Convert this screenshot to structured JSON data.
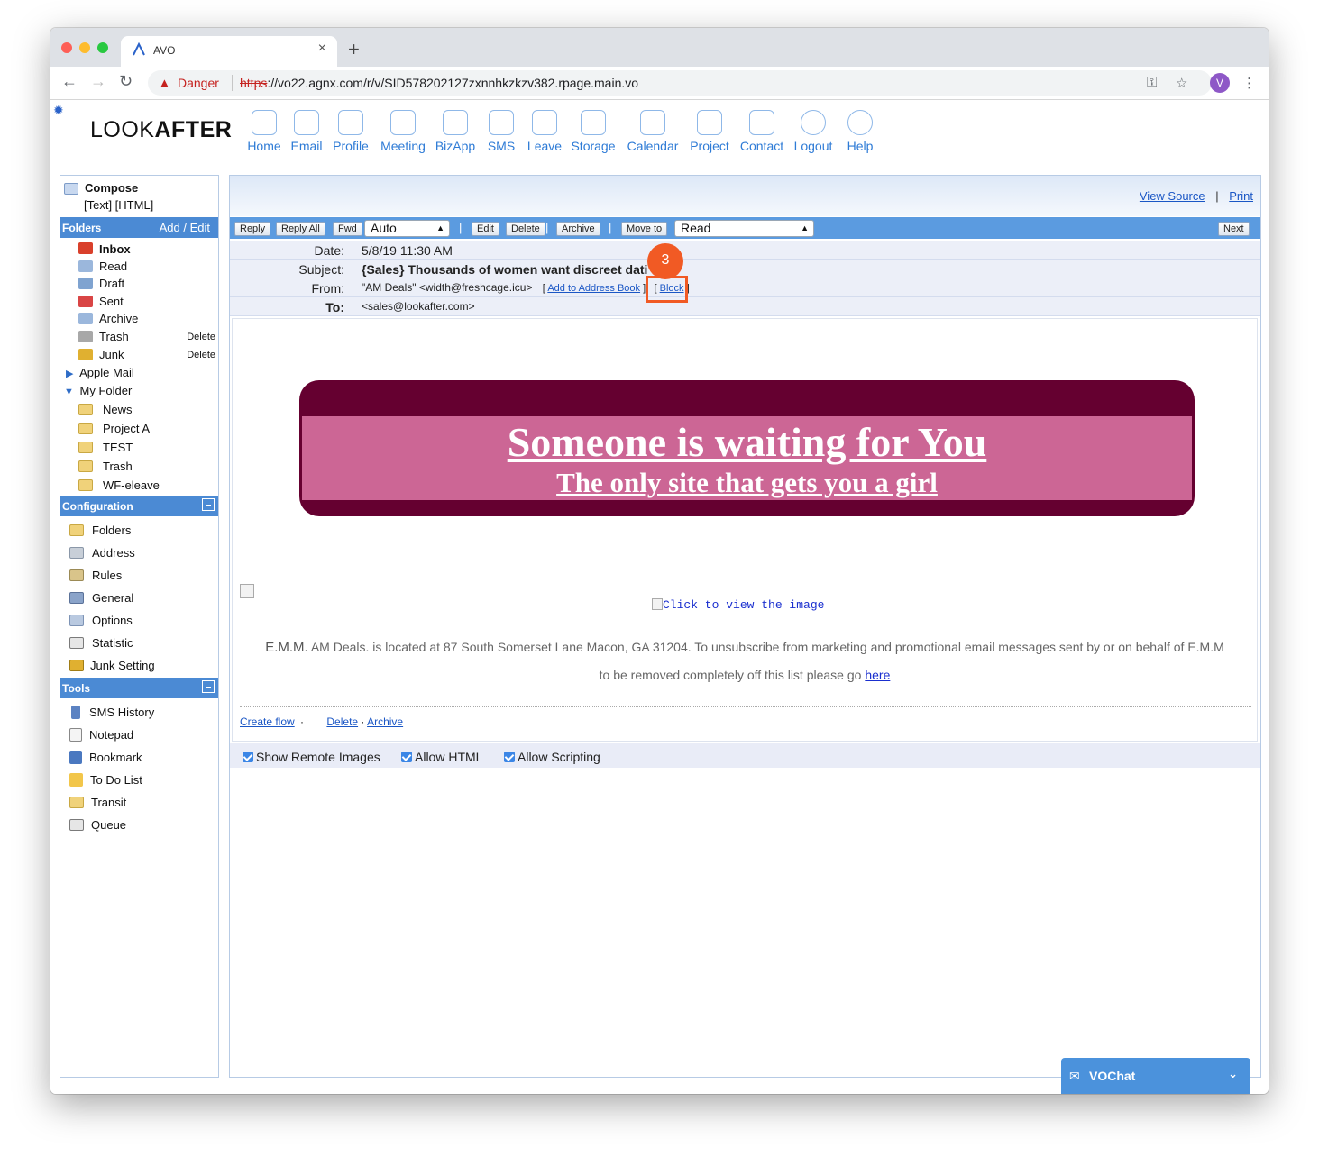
{
  "browser": {
    "tab_title": "AVO",
    "tab_close": "×",
    "new_tab": "+",
    "security_label": "Danger",
    "url_scheme": "https",
    "url_rest": "://vo22.agnx.com/r/v/SID578202127zxnnhkzkzv382.rpage.main.vo",
    "profile_initial": "V"
  },
  "app": {
    "logo_light": "LOOK",
    "logo_bold": "AFTER",
    "nav": [
      {
        "label": "Home",
        "icon": "home-icon"
      },
      {
        "label": "Email",
        "icon": "email-icon"
      },
      {
        "label": "Profile",
        "icon": "profile-icon"
      },
      {
        "label": "Meeting",
        "icon": "meeting-icon"
      },
      {
        "label": "BizApp",
        "icon": "bizapp-icon"
      },
      {
        "label": "SMS",
        "icon": "sms-icon"
      },
      {
        "label": "Leave",
        "icon": "leave-icon"
      },
      {
        "label": "Storage",
        "icon": "storage-icon"
      },
      {
        "label": "Calendar",
        "icon": "calendar-icon"
      },
      {
        "label": "Project",
        "icon": "project-icon"
      },
      {
        "label": "Contact",
        "icon": "contact-icon"
      },
      {
        "label": "Logout",
        "icon": "logout-icon"
      },
      {
        "label": "Help",
        "icon": "help-icon"
      }
    ]
  },
  "sidebar": {
    "compose": "Compose",
    "compose_links": "[Text] [HTML]",
    "folders_header": "Folders",
    "folders_action": "Add / Edit",
    "folders": [
      {
        "label": "Inbox",
        "bold": true,
        "color": "#d9402b"
      },
      {
        "label": "Read",
        "color": "#9bb7dc"
      },
      {
        "label": "Draft",
        "color": "#7fa3d0"
      },
      {
        "label": "Sent",
        "color": "#d94545"
      },
      {
        "label": "Archive",
        "color": "#9bb7dc"
      },
      {
        "label": "Trash",
        "action": "Delete",
        "color": "#a8a8a8"
      },
      {
        "label": "Junk",
        "action": "Delete",
        "color": "#e0b030"
      }
    ],
    "apple_mail": "Apple Mail",
    "my_folder": "My Folder",
    "subfolders": [
      "News",
      "Project A",
      "TEST",
      "Trash",
      "WF-eleave"
    ],
    "config_header": "Configuration",
    "config_items": [
      "Folders",
      "Address",
      "Rules",
      "General",
      "Options",
      "Statistic",
      "Junk Setting"
    ],
    "tools_header": "Tools",
    "tools_items": [
      "SMS History",
      "Notepad",
      "Bookmark",
      "To Do List",
      "Transit",
      "Queue"
    ]
  },
  "message": {
    "view_source": "View Source",
    "divider": "|",
    "print": "Print",
    "actions": {
      "reply": "Reply",
      "reply_all": "Reply All",
      "fwd": "Fwd",
      "encoding": "Auto",
      "edit": "Edit",
      "delete": "Delete",
      "archive": "Archive",
      "move_to": "Move to",
      "move_target": "Read",
      "next": "Next"
    },
    "date_label": "Date:",
    "date": "5/8/19 11:30 AM",
    "subject_label": "Subject:",
    "subject": "{Sales} Thousands of women want discreet dati",
    "from_label": "From:",
    "from": "\"AM Deals\" <width@freshcage.icu>",
    "add_to_address_book": "Add to Address Book",
    "block": "Block",
    "to_label": "To:",
    "to": "<sales@lookafter.com>",
    "step_badge": "3",
    "banner_headline": "Someone is waiting for You ",
    "banner_subline": "The only site that gets you a girl",
    "click_to_view": "Click to view the image",
    "footer_company": "E.M.M.",
    "footer_line1": " AM Deals. is located at 87 South Somerset Lane Macon, GA 31204. To unsubscribe from marketing and promotional email messages sent by or on behalf of E.M.M",
    "footer_line2": "to be removed completely off this list please go ",
    "footer_here": "here",
    "create_flow": "Create flow",
    "delete_link": "Delete",
    "archive_link": "Archive",
    "options": [
      "Show Remote Images",
      "Allow HTML",
      "Allow Scripting"
    ]
  },
  "chat": {
    "label": "VOChat"
  },
  "colors": {
    "accent": "#4b8ad4",
    "banner_dark": "#650030",
    "banner_pink": "#cc6695",
    "highlight": "#f15a24"
  }
}
